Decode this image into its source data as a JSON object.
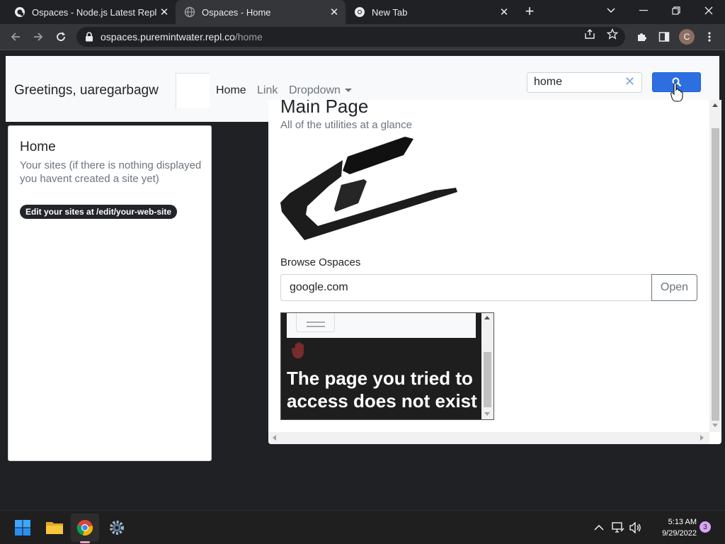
{
  "browser": {
    "tabs": [
      {
        "title": "Ospaces - Node.js Latest Repl - R",
        "favicon": "replit-icon"
      },
      {
        "title": "Ospaces - Home",
        "favicon": "globe-icon"
      },
      {
        "title": "New Tab",
        "favicon": "chrome-icon"
      }
    ],
    "url_host": "ospaces.puremintwater.repl.co",
    "url_path": "/home",
    "profile_initial": "C"
  },
  "page": {
    "navbar": {
      "brand": "Greetings, uaregarbagw",
      "links": [
        "Home",
        "Link",
        "Dropdown"
      ],
      "search_value": "home"
    },
    "home_card": {
      "title": "Home",
      "subtitle": "Your sites (if there is nothing displayed you havent created a site yet)",
      "badge": "Edit your sites at /edit/your-web-site"
    },
    "main": {
      "title": "Main Page",
      "subtitle": "All of the utilities at a glance",
      "browse_label": "Browse Ospaces",
      "browse_value": "google.com",
      "open_label": "Open",
      "iframe_message": "The page you tried to access does not exist"
    }
  },
  "taskbar": {
    "apps": [
      "windows-start-icon",
      "file-explorer-icon",
      "chrome-icon",
      "settings-icon"
    ],
    "time": "5:13 AM",
    "date": "9/29/2022",
    "notifications": "3"
  }
}
